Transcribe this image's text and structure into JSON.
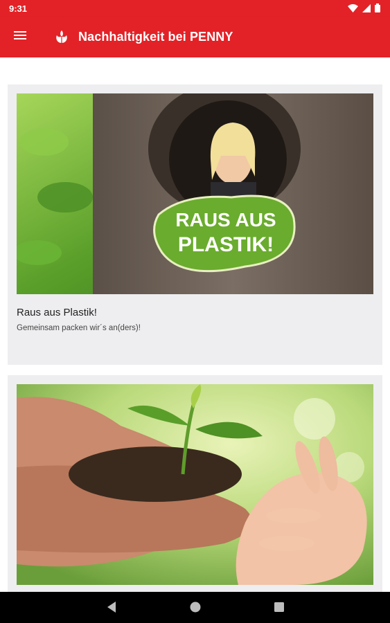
{
  "status_bar": {
    "time": "9:31",
    "icons": [
      "wifi-icon",
      "cellular-icon",
      "battery-icon"
    ]
  },
  "app_bar": {
    "title": "Nachhaltigkeit bei PENNY",
    "menu_icon": "hamburger-menu-icon",
    "logo_icon": "penny-leaf-logo-icon"
  },
  "colors": {
    "brand_red": "#e32227",
    "card_bg": "#eeeef0",
    "sticker_green": "#6aac2e"
  },
  "cards": [
    {
      "title": "Raus aus Plastik!",
      "subtitle": "Gemeinsam packen wir´s an(ders)!",
      "image_text": "RAUS AUS PLASTIK!"
    },
    {
      "title": "",
      "subtitle": ""
    }
  ],
  "nav_bar": {
    "buttons": [
      "back-icon",
      "home-icon",
      "recents-icon"
    ]
  }
}
